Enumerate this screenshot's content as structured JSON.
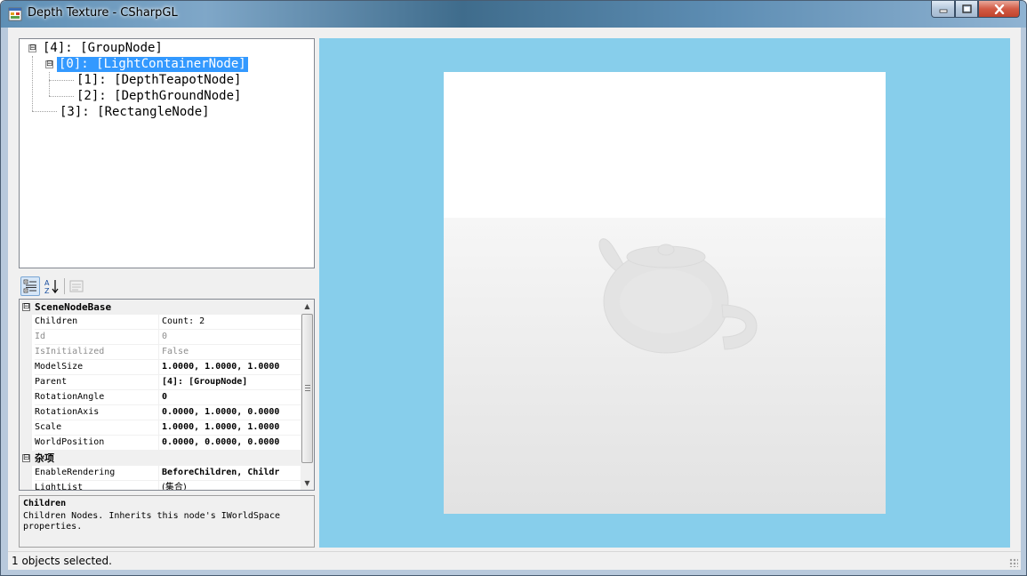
{
  "window": {
    "title": "Depth Texture - CSharpGL",
    "buttons": {
      "minimize": "minimize",
      "maximize": "maximize",
      "close": "close"
    }
  },
  "tree": {
    "nodes": [
      {
        "label": "[4]: [GroupNode]",
        "expander": "⊟"
      },
      {
        "label": "[0]: [LightContainerNode]",
        "expander": "⊟",
        "selected": true
      },
      {
        "label": "[1]: [DepthTeapotNode]"
      },
      {
        "label": "[2]: [DepthGroundNode]"
      },
      {
        "label": "[3]: [RectangleNode]"
      }
    ]
  },
  "toolbar": {
    "categorized_icon": "categorized-icon",
    "alphabetical_icon": "alphabetical-icon",
    "property_pages_icon": "property-pages-icon"
  },
  "property_grid": {
    "categories": [
      {
        "name": "SceneNodeBase",
        "expander": "⊟"
      },
      {
        "name": "杂项",
        "expander": "⊟"
      }
    ],
    "rows": [
      {
        "name": "Children",
        "value": "Count: 2"
      },
      {
        "name": "Id",
        "value": "0",
        "readonly": true
      },
      {
        "name": "IsInitialized",
        "value": "False",
        "readonly": true
      },
      {
        "name": "ModelSize",
        "value": "1.0000, 1.0000, 1.0000",
        "bold": true
      },
      {
        "name": "Parent",
        "value": "[4]: [GroupNode]",
        "bold": true
      },
      {
        "name": "RotationAngle",
        "value": "0",
        "bold": true
      },
      {
        "name": "RotationAxis",
        "value": "0.0000, 1.0000, 0.0000",
        "bold": true
      },
      {
        "name": "Scale",
        "value": "1.0000, 1.0000, 1.0000",
        "bold": true
      },
      {
        "name": "WorldPosition",
        "value": "0.0000, 0.0000, 0.0000",
        "bold": true
      },
      {
        "name": "EnableRendering",
        "value": "BeforeChildren, Childr",
        "bold": true
      },
      {
        "name": "LightList",
        "value": "(集合)"
      }
    ],
    "help": {
      "title": "Children",
      "description": "Children Nodes. Inherits this node's IWorldSpace properties."
    }
  },
  "colors": {
    "viewport_background": "#87ceeb",
    "selection": "#3399ff"
  },
  "status": {
    "text": "1 objects selected."
  }
}
